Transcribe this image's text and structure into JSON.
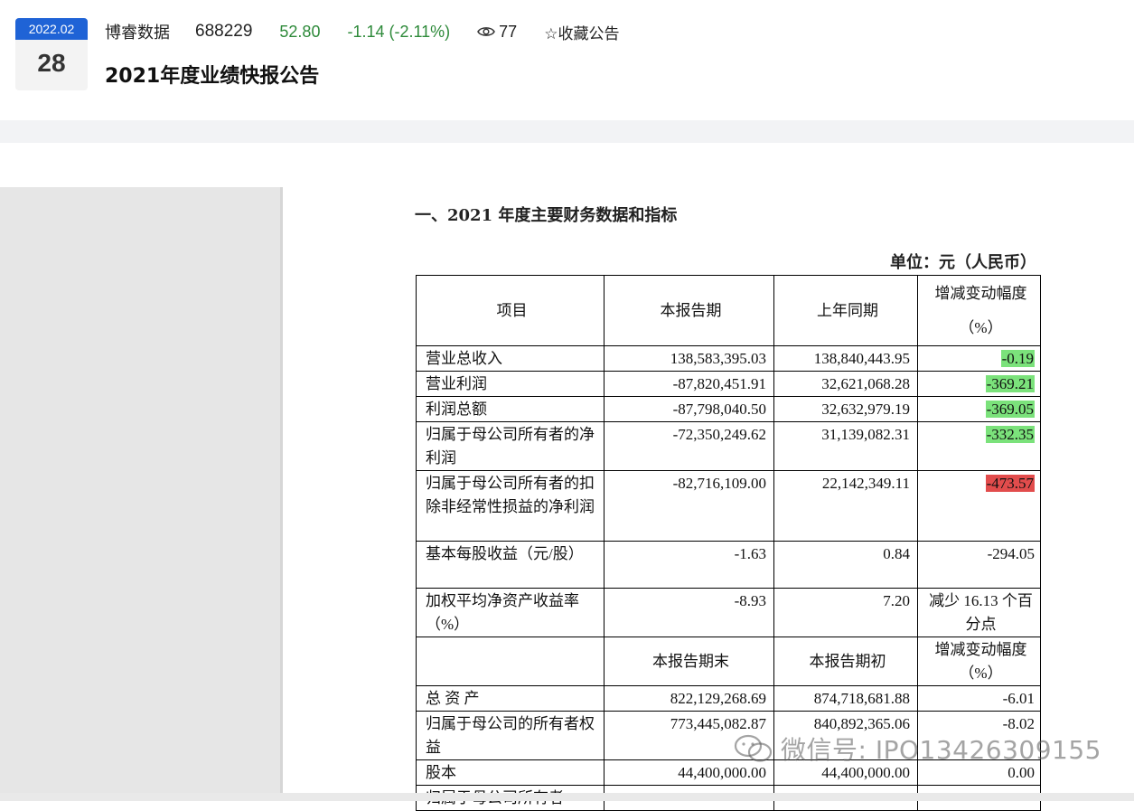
{
  "header": {
    "date_month": "2022.02",
    "date_day": "28",
    "company_name": "博睿数据",
    "stock_code": "688229",
    "price": "52.80",
    "change": "-1.14 (-2.11%)",
    "views": "77",
    "favorite_label": "☆收藏公告",
    "title": "2021年度业绩快报公告",
    "icons": {
      "views": "eye-icon",
      "favorite": "star-icon"
    },
    "colors": {
      "date_bar": "#1f63d6",
      "price_change": "#2e8a3a"
    }
  },
  "document": {
    "heading": "一、2021 年度主要财务数据和指标",
    "unit": "单位：元（人民币）",
    "header_row_1": [
      "项目",
      "本报告期",
      "上年同期",
      "增减变动幅度（%）"
    ],
    "header_row_2": [
      "",
      "本报告期末",
      "本报告期初",
      "增减变动幅度（%）"
    ],
    "rows_period": [
      {
        "item": "营业总收入",
        "current": "138,583,395.03",
        "prior": "138,840,443.95",
        "change": "-0.19",
        "highlight": "green"
      },
      {
        "item": "营业利润",
        "current": "-87,820,451.91",
        "prior": "32,621,068.28",
        "change": "-369.21",
        "highlight": "green"
      },
      {
        "item": "利润总额",
        "current": "-87,798,040.50",
        "prior": "32,632,979.19",
        "change": "-369.05",
        "highlight": "green"
      },
      {
        "item": "归属于母公司所有者的净利润",
        "current": "-72,350,249.62",
        "prior": "31,139,082.31",
        "change": "-332.35",
        "highlight": "green"
      },
      {
        "item": "归属于母公司所有者的扣除非经常性损益的净利润",
        "current": "-82,716,109.00",
        "prior": "22,142,349.11",
        "change": "-473.57",
        "highlight": "red"
      },
      {
        "item": "基本每股收益（元/股）",
        "current": "-1.63",
        "prior": "0.84",
        "change": "-294.05",
        "highlight": ""
      },
      {
        "item": "加权平均净资产收益率（%）",
        "current": "-8.93",
        "prior": "7.20",
        "change": "减少 16.13 个百分点",
        "highlight": ""
      }
    ],
    "rows_balance": [
      {
        "item": "总 资 产",
        "current": "822,129,268.69",
        "prior": "874,718,681.88",
        "change": "-6.01"
      },
      {
        "item": "归属于母公司的所有者权益",
        "current": "773,445,082.87",
        "prior": "840,892,365.06",
        "change": "-8.02"
      },
      {
        "item": "股本",
        "current": "44,400,000.00",
        "prior": "44,400,000.00",
        "change": "0.00"
      },
      {
        "item": "归属于母公司所有者",
        "current": "",
        "prior": "",
        "change": ""
      }
    ],
    "highlight_colors": {
      "green": "#7be27b",
      "red": "#e24c4c"
    }
  },
  "watermark": {
    "text": "微信号: IPO13426309155",
    "icon": "wechat-icon"
  }
}
